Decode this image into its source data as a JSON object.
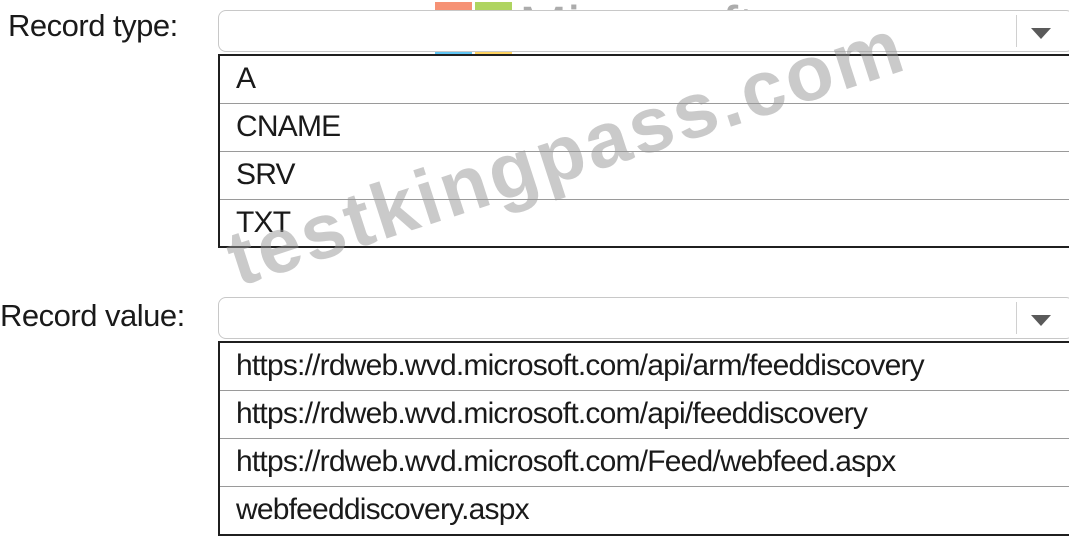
{
  "record_type": {
    "label": "Record type:",
    "selected_value": "",
    "options": [
      "A",
      "CNAME",
      "SRV",
      "TXT"
    ]
  },
  "record_value": {
    "label": "Record value:",
    "selected_value": "",
    "options": [
      "https://rdweb.wvd.microsoft.com/api/arm/feeddiscovery",
      "https://rdweb.wvd.microsoft.com/api/feeddiscovery",
      "https://rdweb.wvd.microsoft.com/Feed/webfeed.aspx",
      "webfeeddiscovery.aspx"
    ]
  },
  "branding": {
    "logo_text": "Microsoft",
    "logo_colors": [
      "#f25022",
      "#7fba00",
      "#00a4ef",
      "#ffb900"
    ],
    "watermark_text": "testkingpass.com"
  },
  "icons": {
    "dropdown_arrow": "chevron-down-icon"
  }
}
